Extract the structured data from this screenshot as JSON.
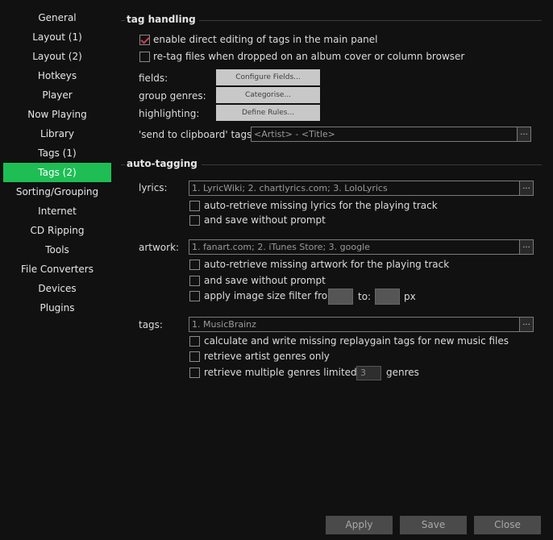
{
  "sidebar": {
    "items": [
      {
        "label": "General",
        "active": false
      },
      {
        "label": "Layout (1)",
        "active": false
      },
      {
        "label": "Layout (2)",
        "active": false
      },
      {
        "label": "Hotkeys",
        "active": false
      },
      {
        "label": "Player",
        "active": false
      },
      {
        "label": "Now Playing",
        "active": false
      },
      {
        "label": "Library",
        "active": false
      },
      {
        "label": "Tags (1)",
        "active": false
      },
      {
        "label": "Tags (2)",
        "active": true
      },
      {
        "label": "Sorting/Grouping",
        "active": false
      },
      {
        "label": "Internet",
        "active": false
      },
      {
        "label": "CD Ripping",
        "active": false
      },
      {
        "label": "Tools",
        "active": false
      },
      {
        "label": "File Converters",
        "active": false
      },
      {
        "label": "Devices",
        "active": false
      },
      {
        "label": "Plugins",
        "active": false
      }
    ]
  },
  "tag_handling": {
    "title": "tag handling",
    "enable_direct_editing": {
      "label": "enable direct editing of tags in the main panel",
      "checked": true
    },
    "retag_files": {
      "label": "re-tag files when dropped on an album cover or column browser",
      "checked": false
    },
    "fields_label": "fields:",
    "fields_button": "Configure Fields...",
    "group_genres_label": "group genres:",
    "group_genres_button": "Categorise...",
    "highlighting_label": "highlighting:",
    "highlighting_button": "Define Rules...",
    "clipboard_label": "'send to clipboard' tags:",
    "clipboard_value": "<Artist> - <Title>",
    "ellipsis": "..."
  },
  "auto_tagging": {
    "title": "auto-tagging",
    "lyrics_label": "lyrics:",
    "lyrics_value": "1. LyricWiki; 2. chartlyrics.com; 3. LoloLyrics",
    "lyrics_auto_retrieve": {
      "label": "auto-retrieve missing lyrics for the playing track",
      "checked": false
    },
    "lyrics_save": {
      "label": "and save without prompt",
      "checked": false
    },
    "artwork_label": "artwork:",
    "artwork_value": "1. fanart.com; 2. iTunes Store; 3. google",
    "artwork_auto_retrieve": {
      "label": "auto-retrieve missing artwork for the playing track",
      "checked": false
    },
    "artwork_save": {
      "label": "and save without prompt",
      "checked": false
    },
    "image_size_filter": {
      "label": "apply image size filter from:",
      "checked": false
    },
    "to_label": "to:",
    "px_label": "px",
    "tags_label": "tags:",
    "tags_value": "1. MusicBrainz",
    "replaygain": {
      "label": "calculate and write missing replaygain tags for new music files",
      "checked": false
    },
    "artist_genres": {
      "label": "retrieve artist genres only",
      "checked": false
    },
    "multiple_genres": {
      "label": "retrieve multiple genres limited to:",
      "checked": false
    },
    "genres_count": "3",
    "genres_label": "genres",
    "ellipsis": "..."
  },
  "footer": {
    "apply": "Apply",
    "save": "Save",
    "close": "Close"
  }
}
